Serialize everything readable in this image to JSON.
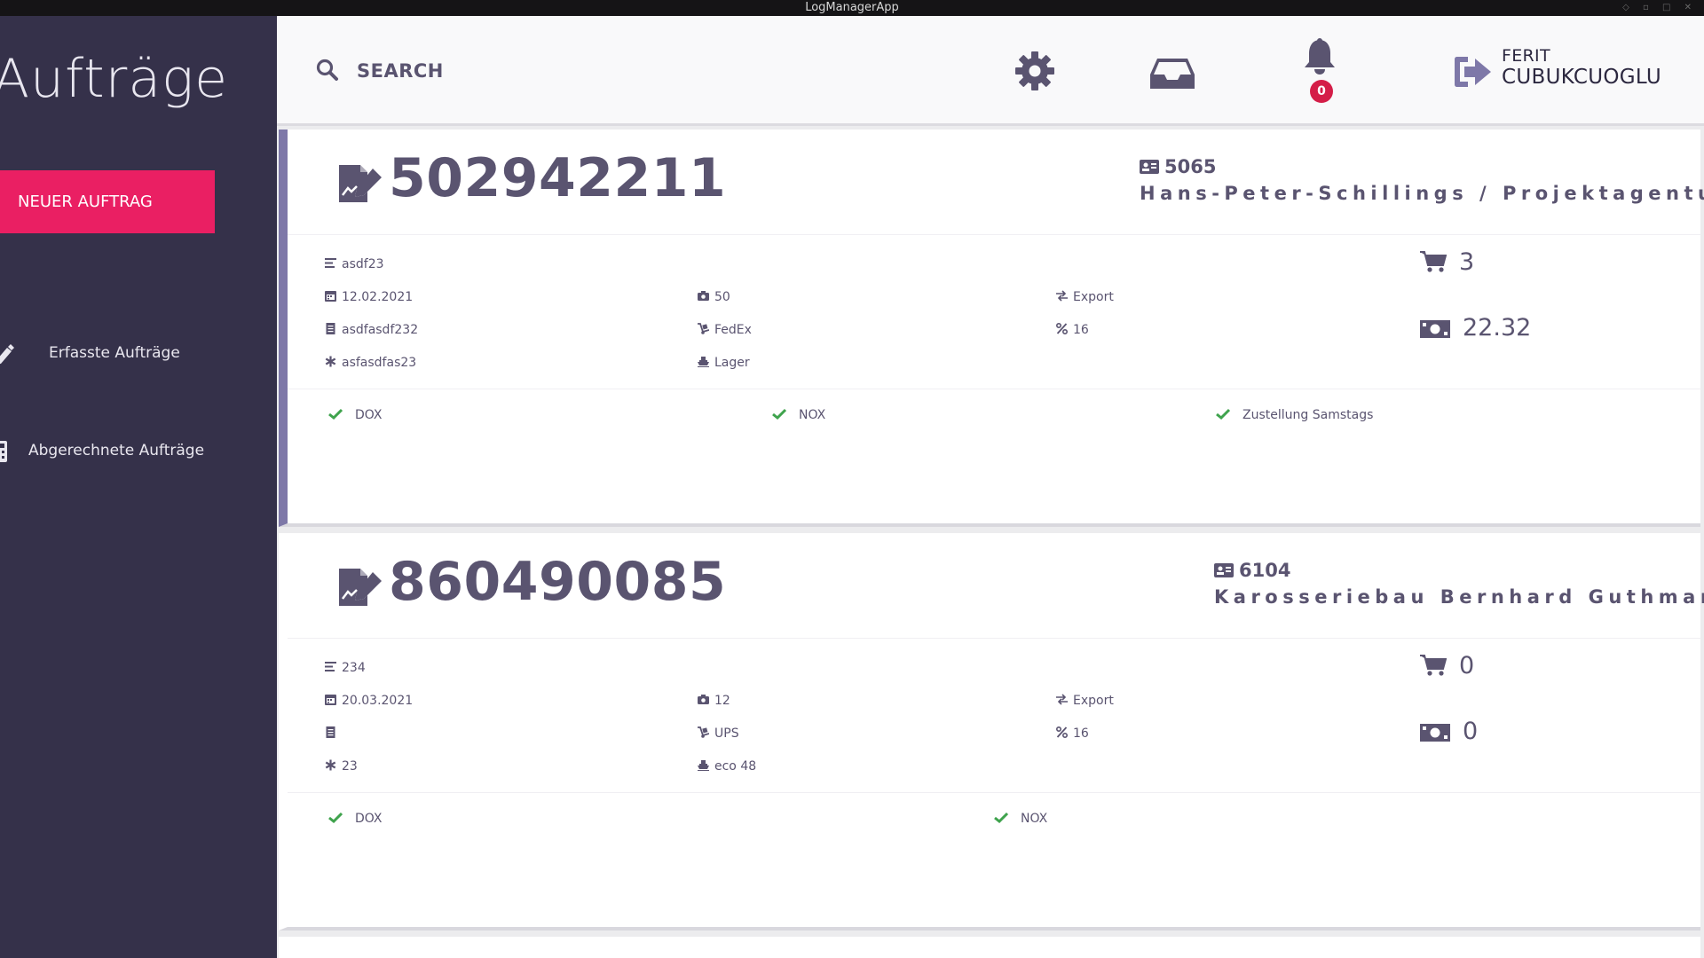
{
  "window": {
    "title": "LogManagerApp"
  },
  "sidebar": {
    "title": "Aufträge",
    "new_order_label": "NEUER AUFTRAG",
    "items": [
      {
        "label": "Erfasste Aufträge",
        "icon": "pencil-icon"
      },
      {
        "label": "Abgerechnete Aufträge",
        "icon": "calculator-icon"
      }
    ]
  },
  "header": {
    "search_label": "SEARCH",
    "notification_count": "0",
    "user_first_name": "FERIT",
    "user_last_name": "CUBUKCUOGLU"
  },
  "colors": {
    "sidebar_bg": "#35314a",
    "accent": "#ea1f63",
    "text": "#5a5470",
    "check": "#3fa34d",
    "badge": "#d41e48"
  },
  "orders": [
    {
      "number": "502942211",
      "customer_id": "5065",
      "customer_name": "Hans-Peter-Schillings / Projektagentur",
      "reference": "asdf23",
      "date": "12.02.2021",
      "tracking": "asdfasdf232",
      "note": "asfasdfas23",
      "packages": "50",
      "carrier": "FedEx",
      "warehouse": "Lager",
      "direction": "Export",
      "tax": "16",
      "cart_count": "3",
      "amount": "22.32",
      "flags": [
        "DOX",
        "NOX",
        "Zustellung Samstags"
      ]
    },
    {
      "number": "860490085",
      "customer_id": "6104",
      "customer_name": "Karosseriebau Bernhard Guthmann",
      "reference": "234",
      "date": "20.03.2021",
      "tracking": "",
      "note": "23",
      "packages": "12",
      "carrier": "UPS",
      "warehouse": "eco 48",
      "direction": "Export",
      "tax": "16",
      "cart_count": "0",
      "amount": "0",
      "flags": [
        "DOX",
        "NOX"
      ]
    }
  ]
}
